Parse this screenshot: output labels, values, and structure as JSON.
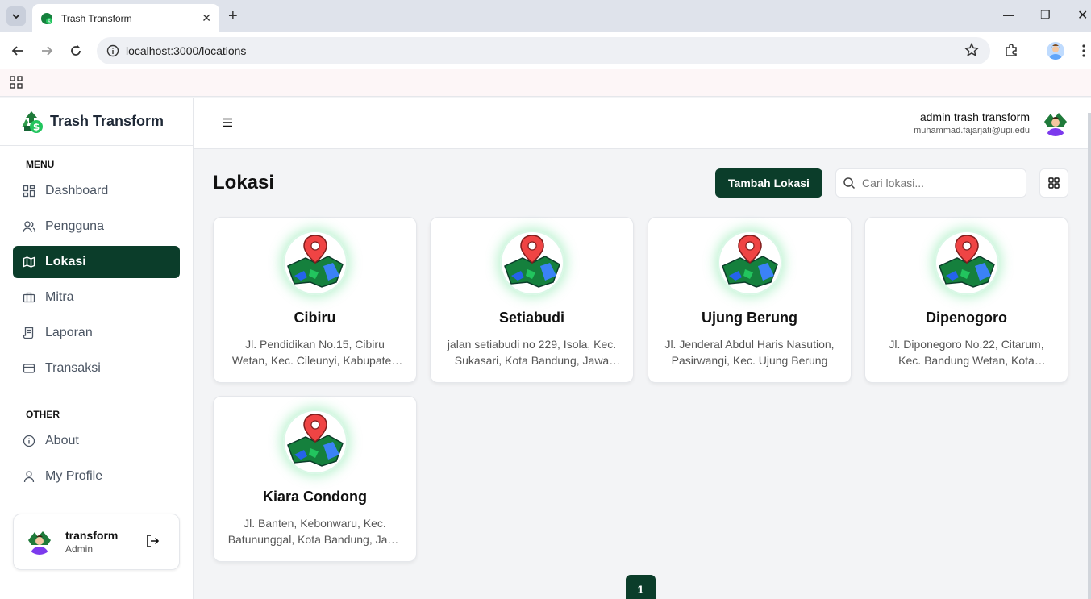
{
  "browser": {
    "tab_title": "Trash Transform",
    "url": "localhost:3000/locations"
  },
  "brand": {
    "name": "Trash Transform"
  },
  "sidebar": {
    "menu_label": "MENU",
    "items": [
      {
        "label": "Dashboard",
        "icon": "dashboard-icon"
      },
      {
        "label": "Pengguna",
        "icon": "users-icon"
      },
      {
        "label": "Lokasi",
        "icon": "map-icon",
        "active": true
      },
      {
        "label": "Mitra",
        "icon": "briefcase-icon"
      },
      {
        "label": "Laporan",
        "icon": "report-icon"
      },
      {
        "label": "Transaksi",
        "icon": "card-icon"
      }
    ],
    "other_label": "OTHER",
    "other_items": [
      {
        "label": "About",
        "icon": "info-icon"
      },
      {
        "label": "My Profile",
        "icon": "user-icon"
      }
    ],
    "user": {
      "name": "transform",
      "role": "Admin"
    }
  },
  "header": {
    "admin_name": "admin trash transform",
    "admin_email": "muhammad.fajarjati@upi.edu"
  },
  "main": {
    "title": "Lokasi",
    "add_label": "Tambah Lokasi",
    "search_placeholder": "Cari lokasi...",
    "locations": [
      {
        "name": "Cibiru",
        "address": "Jl. Pendidikan No.15, Cibiru Wetan, Kec. Cileunyi, Kabupaten Bandung"
      },
      {
        "name": "Setiabudi",
        "address": "jalan setiabudi no 229, Isola, Kec. Sukasari, Kota Bandung, Jawa Barat"
      },
      {
        "name": "Ujung Berung",
        "address": "Jl. Jenderal Abdul Haris Nasution, Pasirwangi, Kec. Ujung Berung"
      },
      {
        "name": "Dipenogoro",
        "address": "Jl. Diponegoro No.22, Citarum, Kec. Bandung Wetan, Kota Bandung"
      },
      {
        "name": "Kiara Condong",
        "address": "Jl. Banten, Kebonwaru, Kec. Batununggal, Kota Bandung, Jawa Barat"
      }
    ],
    "page": "1"
  },
  "colors": {
    "primary": "#0b3d2a",
    "accent": "#4ade80"
  }
}
